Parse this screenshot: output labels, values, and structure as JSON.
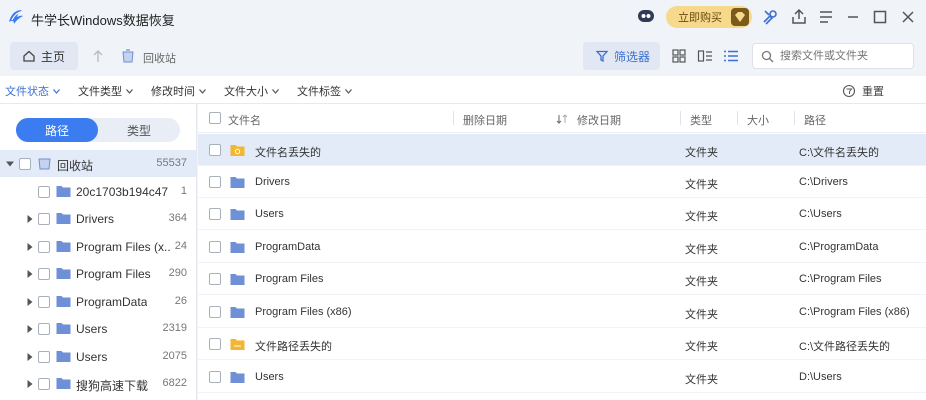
{
  "app": {
    "title": "牛学长Windows数据恢复",
    "buy_label": "立即购买"
  },
  "toolbar": {
    "home_label": "主页",
    "crumb_label": "回收站",
    "filter_label": "筛选器",
    "search_placeholder": "搜索文件或文件夹"
  },
  "filters": {
    "items": [
      "文件状态",
      "文件类型",
      "修改时间",
      "文件大小",
      "文件标签"
    ],
    "reset_label": "重置"
  },
  "sidebar": {
    "tab_path": "路径",
    "tab_type": "类型",
    "tree": [
      {
        "label": "回收站",
        "count": "55537"
      },
      {
        "label": "20c1703b194c47a...",
        "count": "1"
      },
      {
        "label": "Drivers",
        "count": "364"
      },
      {
        "label": "Program Files (x...",
        "count": "24"
      },
      {
        "label": "Program Files",
        "count": "290"
      },
      {
        "label": "ProgramData",
        "count": "26"
      },
      {
        "label": "Users",
        "count": "2319"
      },
      {
        "label": "Users",
        "count": "2075"
      },
      {
        "label": "搜狗高速下载",
        "count": "6822"
      }
    ]
  },
  "table": {
    "headers": {
      "name": "文件名",
      "deleted": "删除日期",
      "modified": "修改日期",
      "type": "类型",
      "size": "大小",
      "path": "路径"
    },
    "rows": [
      {
        "name": "文件名丢失的",
        "type": "文件夹",
        "path": "C:\\文件名丢失的",
        "icon": "lost-folder"
      },
      {
        "name": "Drivers",
        "type": "文件夹",
        "path": "C:\\Drivers",
        "icon": "folder"
      },
      {
        "name": "Users",
        "type": "文件夹",
        "path": "C:\\Users",
        "icon": "folder"
      },
      {
        "name": "ProgramData",
        "type": "文件夹",
        "path": "C:\\ProgramData",
        "icon": "folder"
      },
      {
        "name": "Program Files",
        "type": "文件夹",
        "path": "C:\\Program Files",
        "icon": "folder"
      },
      {
        "name": "Program Files (x86)",
        "type": "文件夹",
        "path": "C:\\Program Files (x86)",
        "icon": "folder"
      },
      {
        "name": "文件路径丢失的",
        "type": "文件夹",
        "path": "C:\\文件路径丢失的",
        "icon": "lost-folder"
      },
      {
        "name": "Users",
        "type": "文件夹",
        "path": "D:\\Users",
        "icon": "folder"
      }
    ]
  },
  "colors": {
    "accent": "#3b7cf0",
    "folder": "#6f8fd6",
    "lost_folder": "#f2b632",
    "selection": "#e3ebf9"
  }
}
